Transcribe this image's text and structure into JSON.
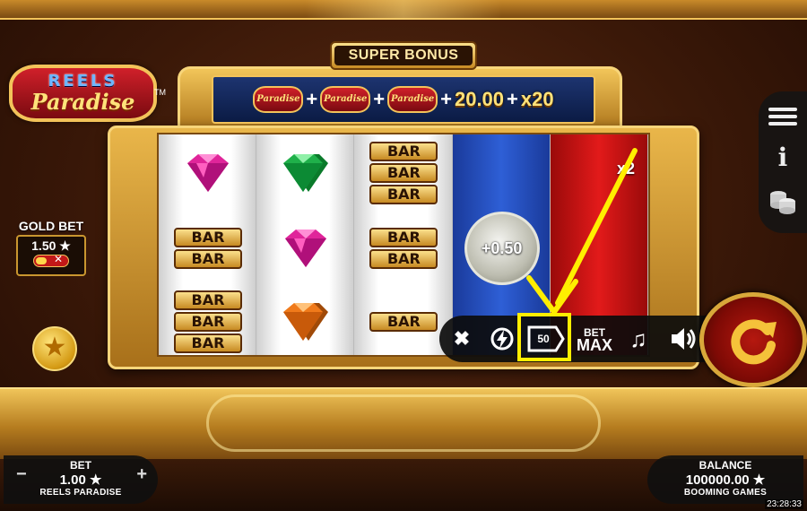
{
  "game": {
    "logo_line1": "REELS",
    "logo_line2": "Paradise",
    "logo_tm": "TM"
  },
  "super_bonus": {
    "label": "SUPER BONUS",
    "mini_logo": "Paradise",
    "plus": "+",
    "amount": "20.00",
    "multiplier": "x20"
  },
  "gold_bet": {
    "label": "GOLD BET",
    "value": "1.50 ★",
    "toggle_state": "off"
  },
  "reels": {
    "reel1": [
      "pink-gem",
      "BAR-BAR",
      "BAR-BAR-BAR"
    ],
    "reel2": [
      "green-gem",
      "pink-gem",
      "orange-gem"
    ],
    "reel3": [
      "BAR-BAR-BAR",
      "BAR-BAR",
      "BAR"
    ],
    "bar_text": "BAR",
    "coin_value": "+0.50",
    "red_multiplier": "x2"
  },
  "controls": {
    "close": "✖",
    "autoplay_count": "50",
    "bet_max_top": "BET",
    "bet_max_bottom": "MAX",
    "music": "♫"
  },
  "bet": {
    "label": "BET",
    "value": "1.00 ★",
    "game_name": "REELS PARADISE",
    "minus": "−",
    "plus": "+"
  },
  "balance": {
    "label": "BALANCE",
    "value": "100000.00 ★",
    "provider": "BOOMING GAMES"
  },
  "clock": "23:28:33",
  "colors": {
    "gold": "#f3c35a",
    "highlight": "#ffee00",
    "spin_red": "#b5180f"
  }
}
